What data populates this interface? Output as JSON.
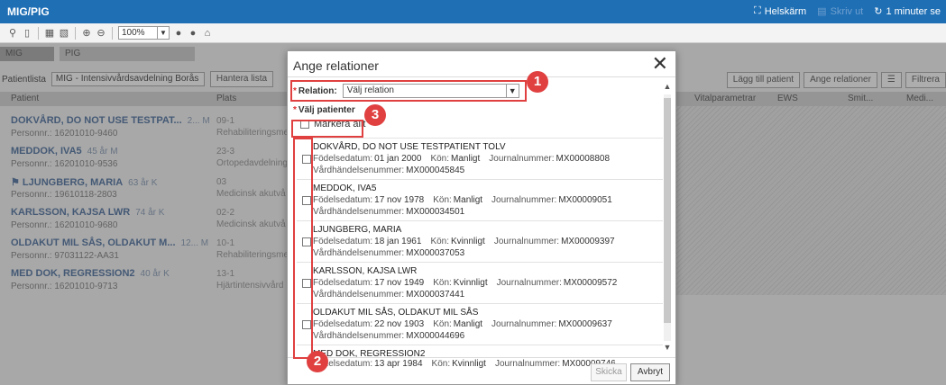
{
  "titlebar": {
    "app_title": "MIG/PIG",
    "fullscreen_label": "Helskärm",
    "print_label": "Skriv ut",
    "refresh_label": "1 minuter se"
  },
  "toolbar": {
    "zoom_value": "100%"
  },
  "tabs": [
    {
      "label": "MIG"
    },
    {
      "label": "PIG"
    }
  ],
  "filter": {
    "label": "Patientlista",
    "list_value": "MIG - Intensivvårdsavdelning Borås",
    "manage_button": "Hantera lista"
  },
  "right_buttons": {
    "add_patient": "Lägg till patient",
    "set_relations": "Ange relationer",
    "filter": "Filtrera"
  },
  "columns": {
    "patient": "Patient",
    "plats": "Plats",
    "vital": "Vitalparametrar",
    "ews": "EWS",
    "smitta": "Smit...",
    "med": "Medi..."
  },
  "bg_patients": [
    {
      "name": "DOKVÅRD, DO NOT USE TESTPAT...",
      "meta": "2... M",
      "personnr": "Personnr.: 16201010-9460",
      "plats_code": "09-1",
      "plats_name": "Rehabiliteringsme"
    },
    {
      "name": "MEDDOK, IVA5",
      "meta": "45 år  M",
      "personnr": "Personnr.: 16201010-9536",
      "plats_code": "23-3",
      "plats_name": "Ortopedavdelning"
    },
    {
      "name": "⚑ LJUNGBERG, MARIA",
      "meta": "63 år  K",
      "personnr": "Personnr.: 19610118-2803",
      "plats_code": "03",
      "plats_name": "Medicinsk akutvå"
    },
    {
      "name": "KARLSSON, KAJSA LWR",
      "meta": "74 år  K",
      "personnr": "Personnr.: 16201010-9680",
      "plats_code": "02-2",
      "plats_name": "Medicinsk akutvå"
    },
    {
      "name": "OLDAKUT MIL SÅS, OLDAKUT M...",
      "meta": "12... M",
      "personnr": "Personnr.: 97031122-AA31",
      "plats_code": "10-1",
      "plats_name": "Rehabiliteringsme"
    },
    {
      "name": "MED DOK, REGRESSION2",
      "meta": "40 år  K",
      "personnr": "Personnr.: 16201010-9713",
      "plats_code": "13-1",
      "plats_name": "Hjärtintensivvård"
    }
  ],
  "dialog": {
    "title": "Ange relationer",
    "relation_label": "Relation:",
    "relation_value": "Välj relation",
    "select_patients_label": "Välj patienter",
    "select_all_label": "Markera allt",
    "send_button": "Skicka",
    "cancel_button": "Avbryt",
    "labels": {
      "birth": "Födelsedatum:",
      "gender": "Kön:",
      "journal": "Journalnummer:",
      "event": "Vårdhändelsenummer:"
    },
    "patients": [
      {
        "name": "DOKVÅRD, DO NOT USE TESTPATIENT TOLV",
        "birth": "01 jan 2000",
        "gender": "Manligt",
        "journal": "MX00008808",
        "event": "MX000045845"
      },
      {
        "name": "MEDDOK, IVA5",
        "birth": "17 nov 1978",
        "gender": "Manligt",
        "journal": "MX00009051",
        "event": "MX000034501"
      },
      {
        "name": "LJUNGBERG, MARIA",
        "birth": "18 jan 1961",
        "gender": "Kvinnligt",
        "journal": "MX00009397",
        "event": "MX000037053"
      },
      {
        "name": "KARLSSON, KAJSA LWR",
        "birth": "17 nov 1949",
        "gender": "Kvinnligt",
        "journal": "MX00009572",
        "event": "MX000037441"
      },
      {
        "name": "OLDAKUT MIL SÅS, OLDAKUT MIL SÅS",
        "birth": "22 nov 1903",
        "gender": "Manligt",
        "journal": "MX00009637",
        "event": "MX000044696"
      },
      {
        "name": "MED DOK, REGRESSION2",
        "birth": "13 apr 1984",
        "gender": "Kvinnligt",
        "journal": "MX00009746",
        "event": ""
      }
    ]
  },
  "annotations": {
    "badge1": "1",
    "badge2": "2",
    "badge3": "3",
    "color": "#e04040"
  }
}
